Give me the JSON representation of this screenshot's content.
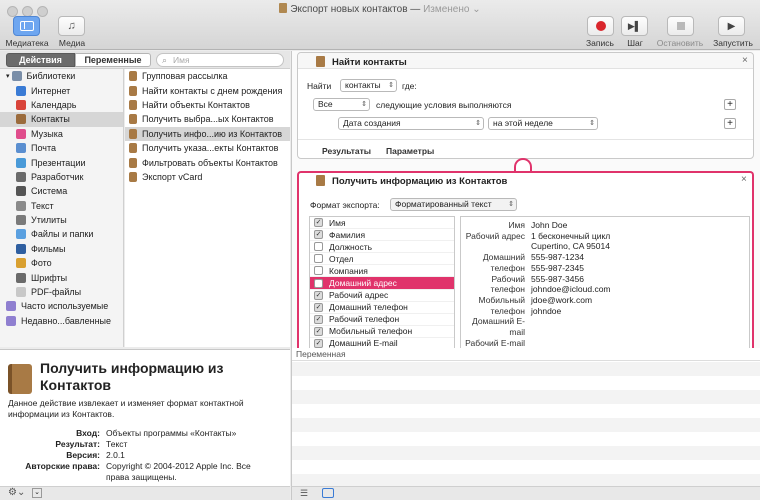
{
  "window": {
    "title": "Экспорт новых контактов",
    "status": "Изменено"
  },
  "toolbar": {
    "library": "Медиатека",
    "media": "Медиа",
    "record": "Запись",
    "step": "Шаг",
    "stop": "Остановить",
    "run": "Запустить"
  },
  "tabs": {
    "actions": "Действия",
    "variables": "Переменные"
  },
  "search": {
    "placeholder": "Имя"
  },
  "categories": [
    {
      "label": "Библиотеки",
      "color": "#7a8ea8"
    },
    {
      "label": "Интернет",
      "color": "#3a7bd5"
    },
    {
      "label": "Календарь",
      "color": "#d9443a"
    },
    {
      "label": "Контакты",
      "color": "#9b6b3c"
    },
    {
      "label": "Музыка",
      "color": "#e04d8c"
    },
    {
      "label": "Почта",
      "color": "#5b8fd0"
    },
    {
      "label": "Презентации",
      "color": "#4a9ad8"
    },
    {
      "label": "Разработчик",
      "color": "#6b6b6b"
    },
    {
      "label": "Система",
      "color": "#555555"
    },
    {
      "label": "Текст",
      "color": "#8a8a8a"
    },
    {
      "label": "Утилиты",
      "color": "#7a7a7a"
    },
    {
      "label": "Файлы и папки",
      "color": "#5aa0e0"
    },
    {
      "label": "Фильмы",
      "color": "#2f5fa0"
    },
    {
      "label": "Фото",
      "color": "#d9a030"
    },
    {
      "label": "Шрифты",
      "color": "#6a6a6a"
    },
    {
      "label": "PDF-файлы",
      "color": "#c8c8c8"
    },
    {
      "label": "Часто используемые",
      "color": "#8f7fd0"
    },
    {
      "label": "Недавно...бавленные",
      "color": "#8f7fd0"
    }
  ],
  "actions": [
    "Групповая рассылка",
    "Найти контакты с днем рождения",
    "Найти объекты Контактов",
    "Получить выбра...ых Контактов",
    "Получить инфо...ию из Контактов",
    "Получить указа...екты Контактов",
    "Фильтровать объекты Контактов",
    "Экспорт vCard"
  ],
  "description": {
    "title": "Получить информацию из Контактов",
    "text": "Данное действие извлекает и изменяет формат контактной информации из Контактов.",
    "rows": [
      {
        "k": "Вход:",
        "v": "Объекты программы «Контакты»"
      },
      {
        "k": "Результат:",
        "v": "Текст"
      },
      {
        "k": "Версия:",
        "v": "2.0.1"
      },
      {
        "k": "Авторские права:",
        "v": "Copyright © 2004-2012 Apple Inc. Все права защищены."
      }
    ]
  },
  "find": {
    "title": "Найти контакты",
    "find_label": "Найти",
    "find_value": "контакты",
    "where_label": "где:",
    "match_value": "Все",
    "match_text": "следующие условия выполняются",
    "field_value": "Дата создания",
    "cond_value": "на этой неделе",
    "tab_results": "Результаты",
    "tab_params": "Параметры"
  },
  "getinfo": {
    "title": "Получить информацию из Контактов",
    "format_label": "Формат экспорта:",
    "format_value": "Форматированный текст",
    "fields": [
      {
        "label": "Имя",
        "checked": true
      },
      {
        "label": "Фамилия",
        "checked": true
      },
      {
        "label": "Должность",
        "checked": false
      },
      {
        "label": "Отдел",
        "checked": false
      },
      {
        "label": "Компания",
        "checked": false
      },
      {
        "label": "Домашний адрес",
        "checked": false
      },
      {
        "label": "Рабочий адрес",
        "checked": true
      },
      {
        "label": "Домашний телефон",
        "checked": true
      },
      {
        "label": "Рабочий телефон",
        "checked": true
      },
      {
        "label": "Мобильный телефон",
        "checked": true
      },
      {
        "label": "Домашний E-mail",
        "checked": true
      }
    ],
    "preview": [
      {
        "k": "Имя",
        "v": "John Doe"
      },
      {
        "k": "Рабочий адрес",
        "v": "1 бесконечный цикл"
      },
      {
        "k": "",
        "v": "Cupertino, CA 95014"
      },
      {
        "k": "Домашний",
        "v": "555-987-1234"
      },
      {
        "k": "телефон",
        "v": "555-987-2345"
      },
      {
        "k": "Рабочий",
        "v": "555-987-3456"
      },
      {
        "k": "телефон",
        "v": "johndoe@icloud.com"
      },
      {
        "k": "Мобильный",
        "v": "jdoe@work.com"
      },
      {
        "k": "телефон",
        "v": "johndoe"
      },
      {
        "k": "Домашний E-",
        "v": ""
      },
      {
        "k": "mail",
        "v": ""
      },
      {
        "k": "Рабочий E-mail",
        "v": ""
      }
    ]
  },
  "log": {
    "header": "Переменная"
  },
  "colors": {
    "accent": "#e0336b",
    "record": "#d9262c"
  }
}
